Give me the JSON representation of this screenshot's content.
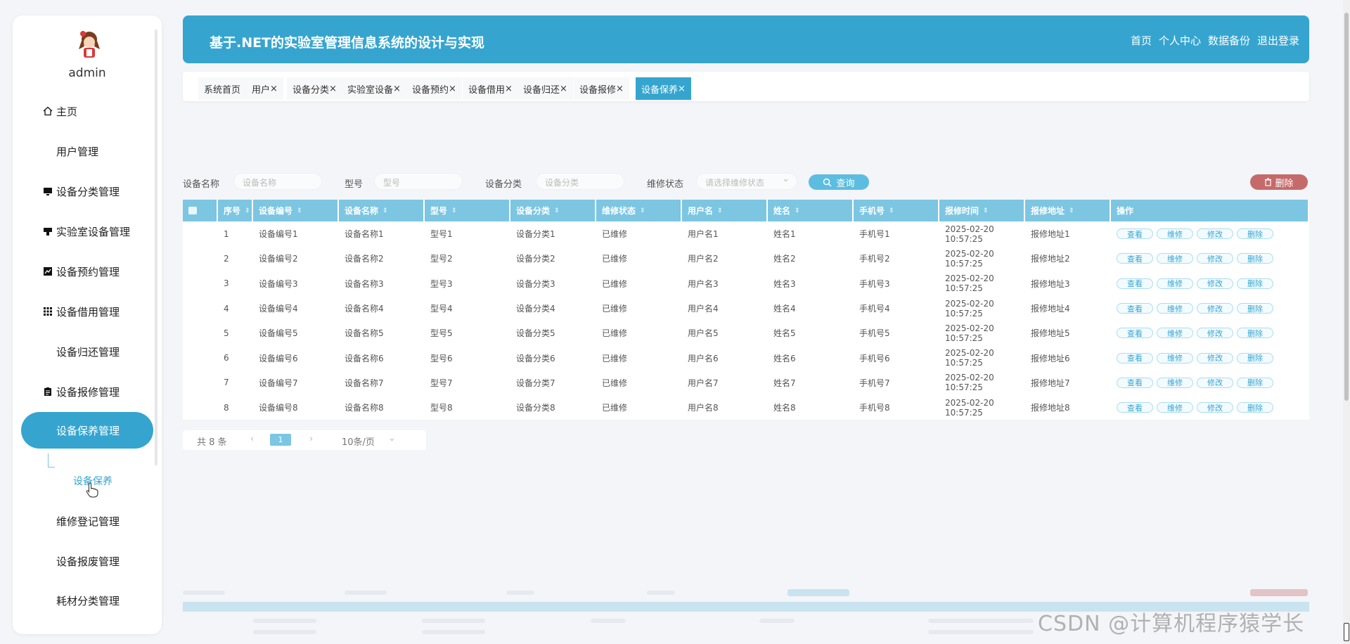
{
  "sidebar": {
    "username": "admin",
    "items": [
      {
        "label": "主页",
        "icon": "home-icon"
      },
      {
        "label": "用户管理",
        "icon": "grid-icon"
      },
      {
        "label": "设备分类管理",
        "icon": "monitor-icon"
      },
      {
        "label": "实验室设备管理",
        "icon": "device-icon"
      },
      {
        "label": "设备预约管理",
        "icon": "chart-icon"
      },
      {
        "label": "设备借用管理",
        "icon": "grid9-icon"
      },
      {
        "label": "设备归还管理",
        "icon": "grid-icon"
      },
      {
        "label": "设备报修管理",
        "icon": "clipboard-icon"
      },
      {
        "label": "设备保养管理",
        "icon": "grid-icon"
      },
      {
        "label": "维修登记管理",
        "icon": "grid-icon"
      },
      {
        "label": "设备报废管理",
        "icon": "grid-icon"
      },
      {
        "label": "耗材分类管理",
        "icon": "grid-icon"
      }
    ],
    "submenu_item": "设备保养"
  },
  "header": {
    "title": "基于.NET的实验室管理信息系统的设计与实现",
    "nav": [
      "首页",
      "个人中心",
      "数据备份",
      "退出登录"
    ]
  },
  "tabs": [
    {
      "label": "系统首页",
      "closable": false
    },
    {
      "label": "用户",
      "closable": true
    },
    {
      "label": "设备分类",
      "closable": true
    },
    {
      "label": "实验室设备",
      "closable": true
    },
    {
      "label": "设备预约",
      "closable": true
    },
    {
      "label": "设备借用",
      "closable": true
    },
    {
      "label": "设备归还",
      "closable": true
    },
    {
      "label": "设备报修",
      "closable": true
    },
    {
      "label": "设备保养",
      "closable": true,
      "active": true
    }
  ],
  "search": {
    "name_label": "设备名称",
    "name_placeholder": "设备名称",
    "model_label": "型号",
    "model_placeholder": "型号",
    "category_label": "设备分类",
    "category_placeholder": "设备分类",
    "status_label": "维修状态",
    "status_placeholder": "请选择维修状态",
    "query_button": "查询",
    "delete_button": "删除"
  },
  "table": {
    "headers": [
      "序号",
      "设备编号",
      "设备名称",
      "型号",
      "设备分类",
      "维修状态",
      "用户名",
      "姓名",
      "手机号",
      "报修时间",
      "报修地址",
      "操作"
    ],
    "rows": [
      [
        "1",
        "设备编号1",
        "设备名称1",
        "型号1",
        "设备分类1",
        "已维修",
        "用户名1",
        "姓名1",
        "手机号1",
        "2025-02-20 10:57:25",
        "报修地址1"
      ],
      [
        "2",
        "设备编号2",
        "设备名称2",
        "型号2",
        "设备分类2",
        "已维修",
        "用户名2",
        "姓名2",
        "手机号2",
        "2025-02-20 10:57:25",
        "报修地址2"
      ],
      [
        "3",
        "设备编号3",
        "设备名称3",
        "型号3",
        "设备分类3",
        "已维修",
        "用户名3",
        "姓名3",
        "手机号3",
        "2025-02-20 10:57:25",
        "报修地址3"
      ],
      [
        "4",
        "设备编号4",
        "设备名称4",
        "型号4",
        "设备分类4",
        "已维修",
        "用户名4",
        "姓名4",
        "手机号4",
        "2025-02-20 10:57:25",
        "报修地址4"
      ],
      [
        "5",
        "设备编号5",
        "设备名称5",
        "型号5",
        "设备分类5",
        "已维修",
        "用户名5",
        "姓名5",
        "手机号5",
        "2025-02-20 10:57:25",
        "报修地址5"
      ],
      [
        "6",
        "设备编号6",
        "设备名称6",
        "型号6",
        "设备分类6",
        "已维修",
        "用户名6",
        "姓名6",
        "手机号6",
        "2025-02-20 10:57:25",
        "报修地址6"
      ],
      [
        "7",
        "设备编号7",
        "设备名称7",
        "型号7",
        "设备分类7",
        "已维修",
        "用户名7",
        "姓名7",
        "手机号7",
        "2025-02-20 10:57:25",
        "报修地址7"
      ],
      [
        "8",
        "设备编号8",
        "设备名称8",
        "型号8",
        "设备分类8",
        "已维修",
        "用户名8",
        "姓名8",
        "手机号8",
        "2025-02-20 10:57:25",
        "报修地址8"
      ]
    ],
    "actions": [
      "查看",
      "维修",
      "修改",
      "删除"
    ]
  },
  "pagination": {
    "total": "共 8 条",
    "current_page": "1",
    "page_size": "10条/页"
  },
  "watermark": "CSDN @计算机程序猿学长",
  "colors": {
    "primary": "#35a5cf",
    "table_header": "#7cc6e2",
    "danger": "#c56a6a"
  }
}
